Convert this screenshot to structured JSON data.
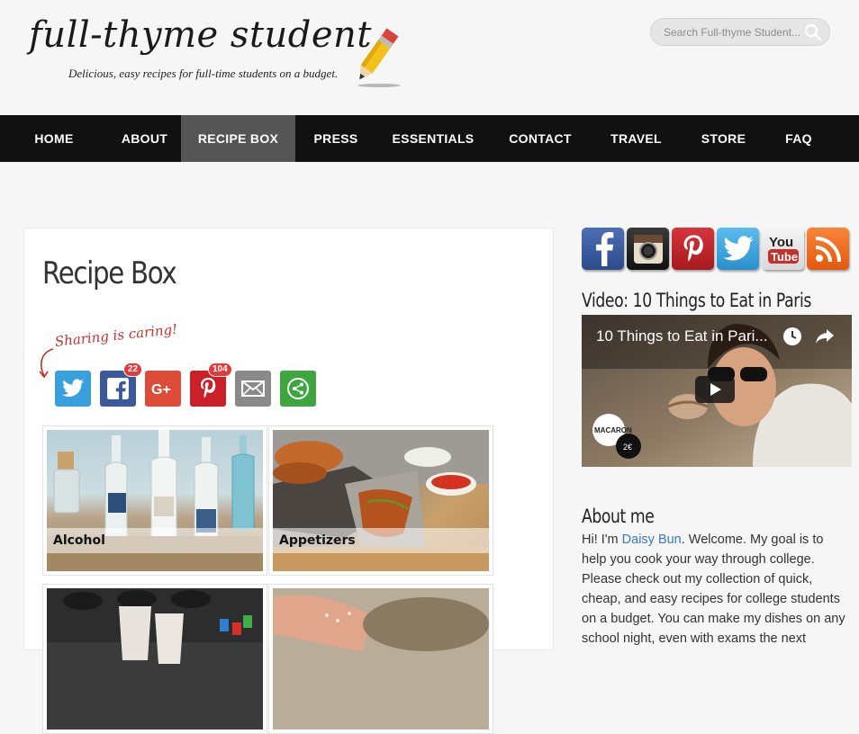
{
  "site": {
    "title": "full-thyme student",
    "tagline": "Delicious, easy recipes for full-time students on a budget."
  },
  "search": {
    "placeholder": "Search Full-thyme Student..."
  },
  "nav": {
    "items": [
      {
        "label": "HOME"
      },
      {
        "label": "ABOUT"
      },
      {
        "label": "RECIPE BOX",
        "active": true
      },
      {
        "label": "PRESS"
      },
      {
        "label": "ESSENTIALS"
      },
      {
        "label": "CONTACT"
      },
      {
        "label": "TRAVEL"
      },
      {
        "label": "STORE"
      },
      {
        "label": "FAQ"
      }
    ]
  },
  "main": {
    "title": "Recipe Box",
    "sharing_label": "Sharing is caring!",
    "share_buttons": [
      {
        "name": "twitter",
        "icon": "twitter-icon",
        "color": "#3aa0dd"
      },
      {
        "name": "facebook",
        "icon": "facebook-icon",
        "color": "#3b5998",
        "count": "22"
      },
      {
        "name": "google-plus",
        "icon": "google-plus-icon",
        "color": "#dd4b39"
      },
      {
        "name": "pinterest",
        "icon": "pinterest-icon",
        "color": "#cb2027",
        "count": "104"
      },
      {
        "name": "email",
        "icon": "email-icon",
        "color": "#8a8a8a"
      },
      {
        "name": "more",
        "icon": "share-icon",
        "color": "#3fa63f"
      }
    ],
    "categories": [
      {
        "label": "Alcohol"
      },
      {
        "label": "Appetizers"
      },
      {
        "label": ""
      },
      {
        "label": ""
      }
    ]
  },
  "sidebar": {
    "social": [
      {
        "name": "facebook",
        "icon": "facebook-icon",
        "color": "#3b5998"
      },
      {
        "name": "instagram",
        "icon": "instagram-icon",
        "color": "#2b2b2b"
      },
      {
        "name": "pinterest",
        "icon": "pinterest-icon",
        "color": "#c8232c"
      },
      {
        "name": "twitter",
        "icon": "twitter-icon",
        "color": "#33a3e0"
      },
      {
        "name": "youtube",
        "icon": "youtube-icon",
        "color": "#e9e9e9"
      },
      {
        "name": "rss",
        "icon": "rss-icon",
        "color": "#f26d21"
      }
    ],
    "video_widget_title": "Video: 10 Things to Eat in Paris",
    "video_title": "10 Things to Eat in Pari...",
    "about_title": "About me",
    "about_text_before": "Hi! I'm ",
    "about_link": "Daisy Bun",
    "about_text_after": ". Welcome. My goal is to help you cook your way through college. Please check out my collection of quick, cheap, and easy recipes for college students on a budget. You can make my dishes on any school night, even with exams the next"
  }
}
